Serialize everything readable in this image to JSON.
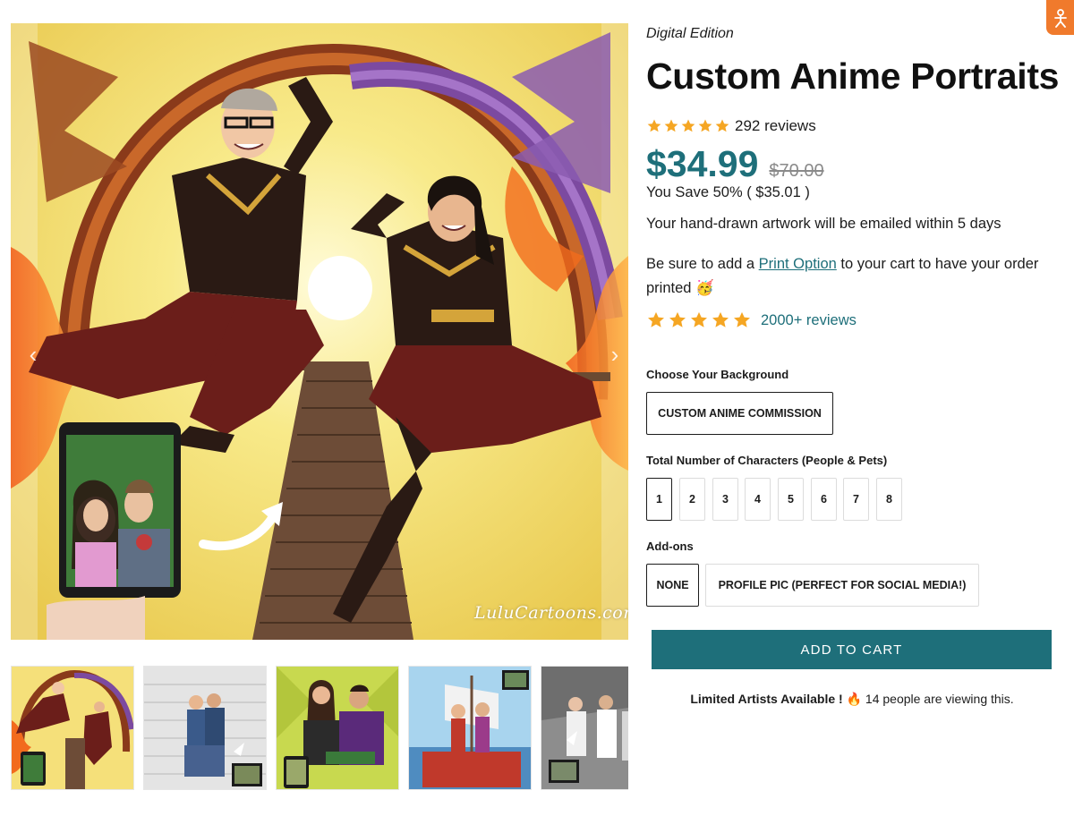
{
  "gallery": {
    "watermark": "LuluCartoons.com",
    "prev_icon": "chevron-left-icon",
    "next_icon": "chevron-right-icon",
    "thumbnail_count": 5
  },
  "product": {
    "edition": "Digital Edition",
    "title": "Custom Anime Portraits",
    "rating": {
      "stars": 5,
      "count_text": "292 reviews"
    },
    "price": "$34.99",
    "compare_at_price": "$70.00",
    "savings_text": "You Save 50% ( $35.01 )",
    "delivery_text": "Your hand-drawn artwork will be emailed within 5 days",
    "print_note": {
      "before": "Be sure to add a ",
      "link": "Print Option",
      "after": " to your cart to have your order printed 🥳"
    },
    "secondary_rating": {
      "stars": 5,
      "text": "2000+ reviews"
    }
  },
  "options": {
    "background": {
      "label": "Choose Your Background",
      "values": [
        "CUSTOM ANIME COMMISSION"
      ],
      "selected": "CUSTOM ANIME COMMISSION"
    },
    "characters": {
      "label": "Total Number of Characters (People & Pets)",
      "values": [
        "1",
        "2",
        "3",
        "4",
        "5",
        "6",
        "7",
        "8"
      ],
      "selected": "1"
    },
    "addons": {
      "label": "Add-ons",
      "values": [
        "NONE",
        "PROFILE PIC (PERFECT FOR SOCIAL MEDIA!)"
      ],
      "selected": "NONE"
    }
  },
  "cart": {
    "button_label": "ADD TO CART"
  },
  "urgency": {
    "bold": "Limited Artists Available ! 🔥",
    "rest": " 14 people are viewing this."
  },
  "colors": {
    "accent": "#1e6f7a",
    "star": "#f5a623",
    "widget": "#f07a2c"
  }
}
